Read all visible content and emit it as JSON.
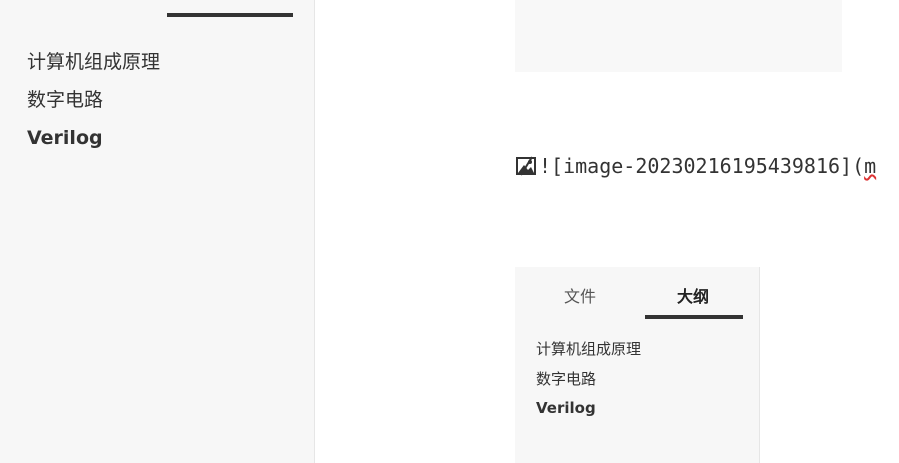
{
  "sidebar": {
    "items": [
      {
        "label": "计算机组成原理",
        "active": false
      },
      {
        "label": "数字电路",
        "active": false
      },
      {
        "label": "Verilog",
        "active": true
      }
    ]
  },
  "editor": {
    "markdown_line": {
      "text": "![image-20230216195439816](",
      "tail": "m",
      "icon": "broken-image-icon"
    }
  },
  "embedded_sidebar": {
    "tabs": [
      {
        "label": "文件",
        "active": false
      },
      {
        "label": "大纲",
        "active": true
      }
    ],
    "items": [
      {
        "label": "计算机组成原理",
        "active": false
      },
      {
        "label": "数字电路",
        "active": false
      },
      {
        "label": "Verilog",
        "active": true
      }
    ]
  },
  "colors": {
    "sidebar_bg": "#f7f7f7",
    "text": "#333333",
    "accent_underline": "#333333"
  }
}
